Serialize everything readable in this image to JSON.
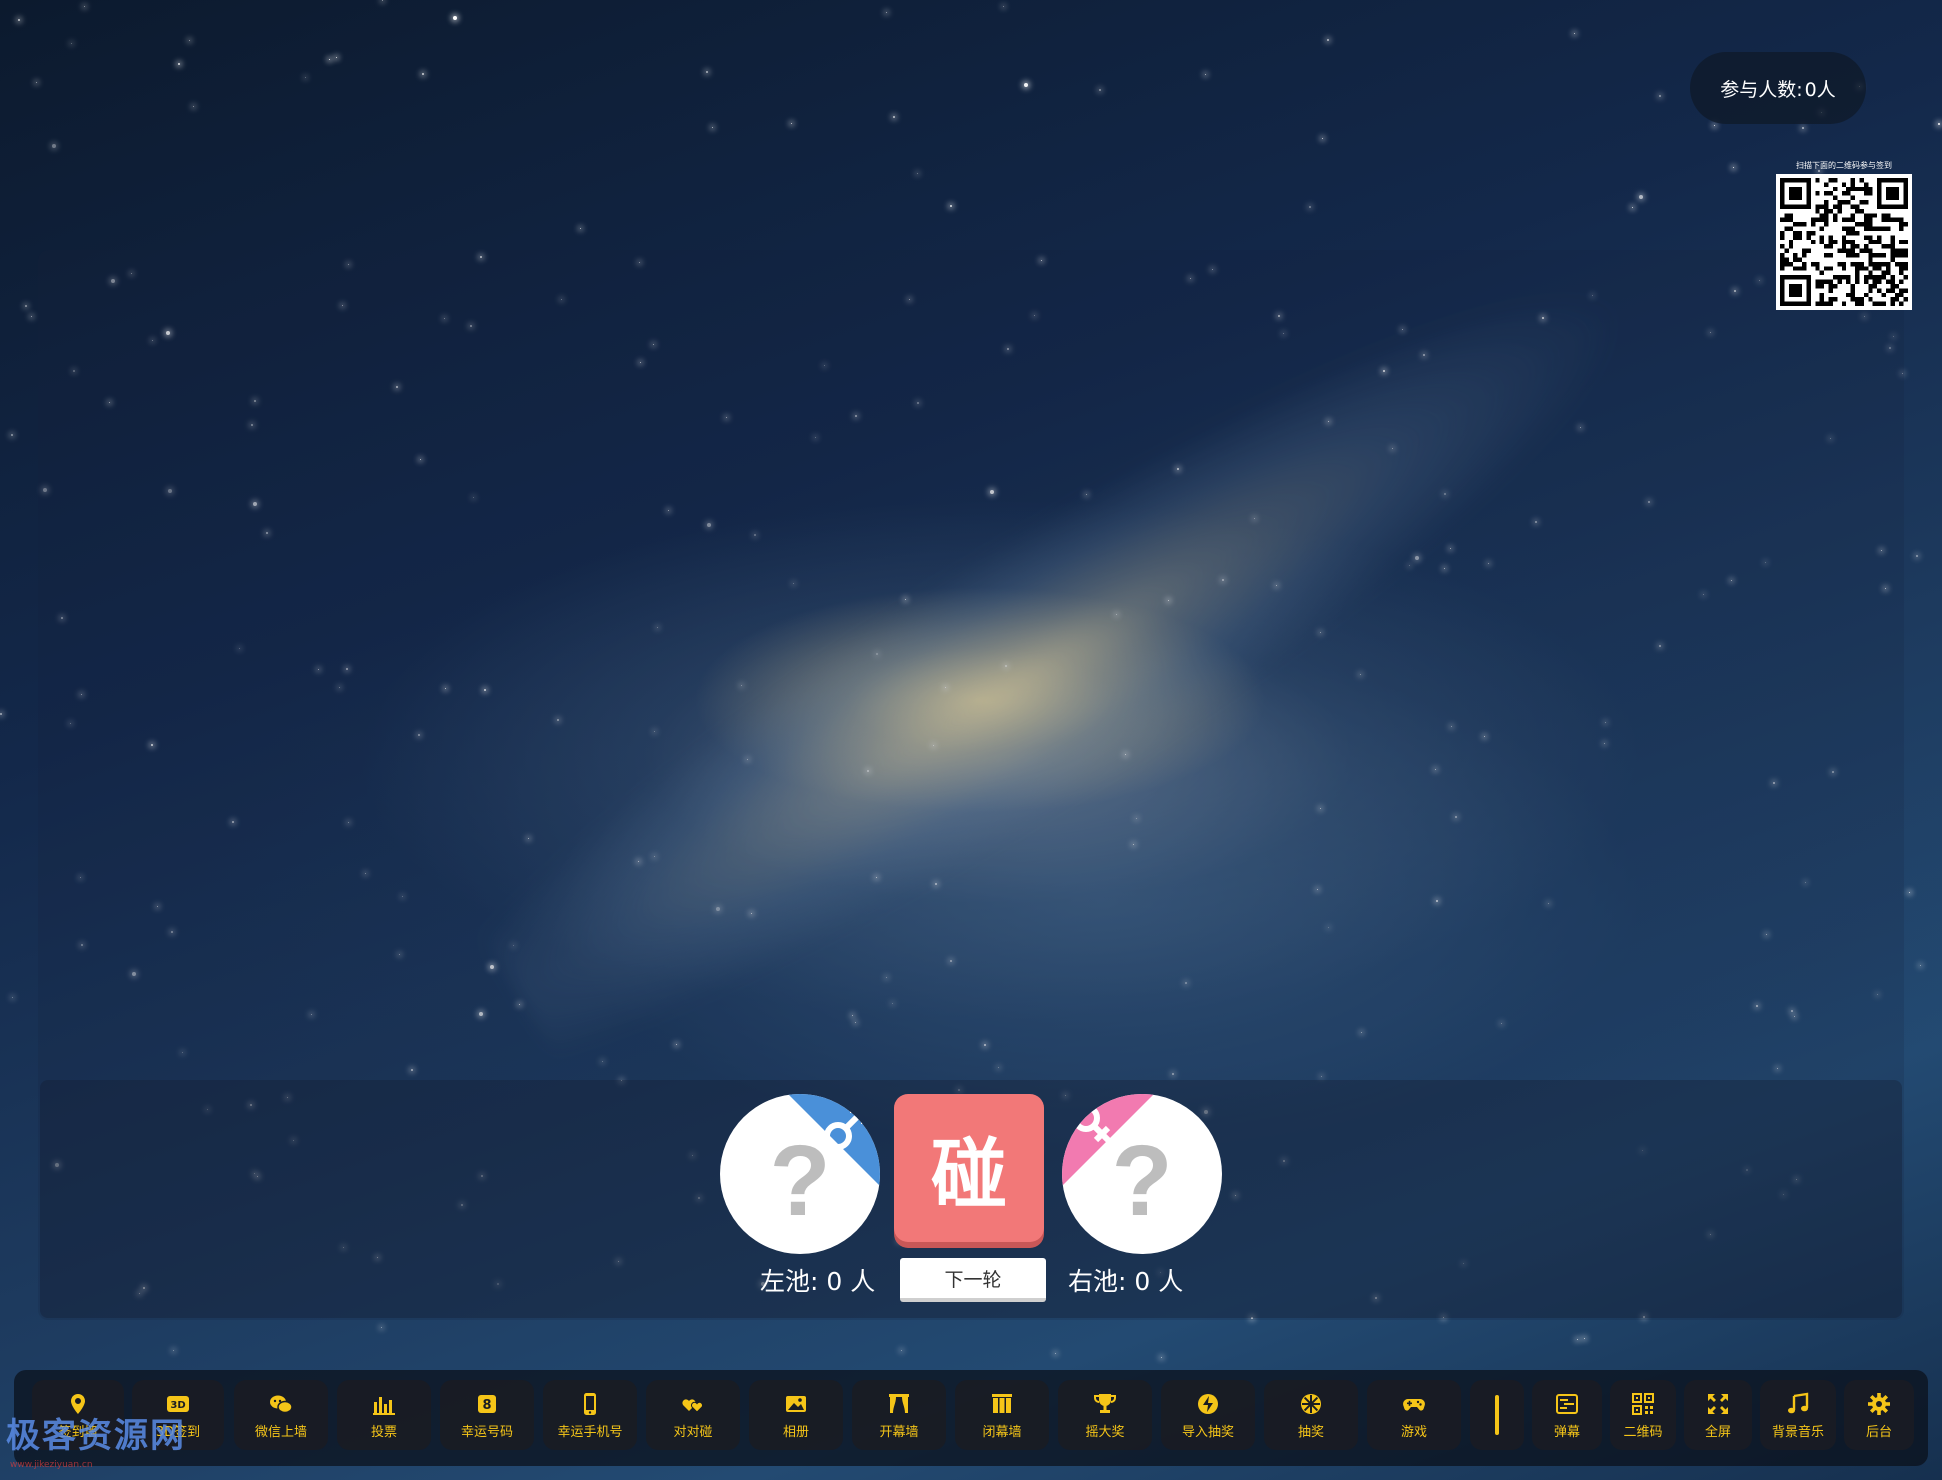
{
  "stats": {
    "participants_label": "参与人数:",
    "participants_value": "0人"
  },
  "qr": {
    "caption": "扫描下面的二维码参与签到"
  },
  "match": {
    "left_slot_mark": "?",
    "right_slot_mark": "?",
    "bump_label": "碰",
    "left_pool_label": "左池:",
    "left_pool_count": "0",
    "left_pool_unit": "人",
    "right_pool_label": "右池:",
    "right_pool_count": "0",
    "right_pool_unit": "人",
    "next_round_label": "下一轮",
    "male_color": "#4a90d9",
    "female_color": "#f27ab0"
  },
  "toolbar": {
    "accent": "#f5c518",
    "items": [
      {
        "label": "签到墙",
        "icon": "map-pin-icon"
      },
      {
        "label": "3D签到",
        "icon": "3d-icon"
      },
      {
        "label": "微信上墙",
        "icon": "wechat-icon"
      },
      {
        "label": "投票",
        "icon": "bar-chart-icon"
      },
      {
        "label": "幸运号码",
        "icon": "lucky-number-icon"
      },
      {
        "label": "幸运手机号",
        "icon": "phone-icon"
      },
      {
        "label": "对对碰",
        "icon": "hearts-icon"
      },
      {
        "label": "相册",
        "icon": "image-icon"
      },
      {
        "label": "开幕墙",
        "icon": "curtain-open-icon"
      },
      {
        "label": "闭幕墙",
        "icon": "curtain-close-icon"
      },
      {
        "label": "摇大奖",
        "icon": "trophy-icon"
      },
      {
        "label": "导入抽奖",
        "icon": "import-lottery-icon"
      },
      {
        "label": "抽奖",
        "icon": "lottery-wheel-icon"
      },
      {
        "label": "游戏",
        "icon": "gamepad-icon"
      },
      {
        "label": "",
        "icon": "separator-bar-icon"
      },
      {
        "label": "弹幕",
        "icon": "danmaku-icon"
      },
      {
        "label": "二维码",
        "icon": "qrcode-icon"
      },
      {
        "label": "全屏",
        "icon": "fullscreen-icon"
      },
      {
        "label": "背景音乐",
        "icon": "music-icon"
      },
      {
        "label": "后台",
        "icon": "gear-icon"
      }
    ]
  },
  "watermark": {
    "text": "极客资源网",
    "sub": "www.jikeziyuan.cn"
  }
}
